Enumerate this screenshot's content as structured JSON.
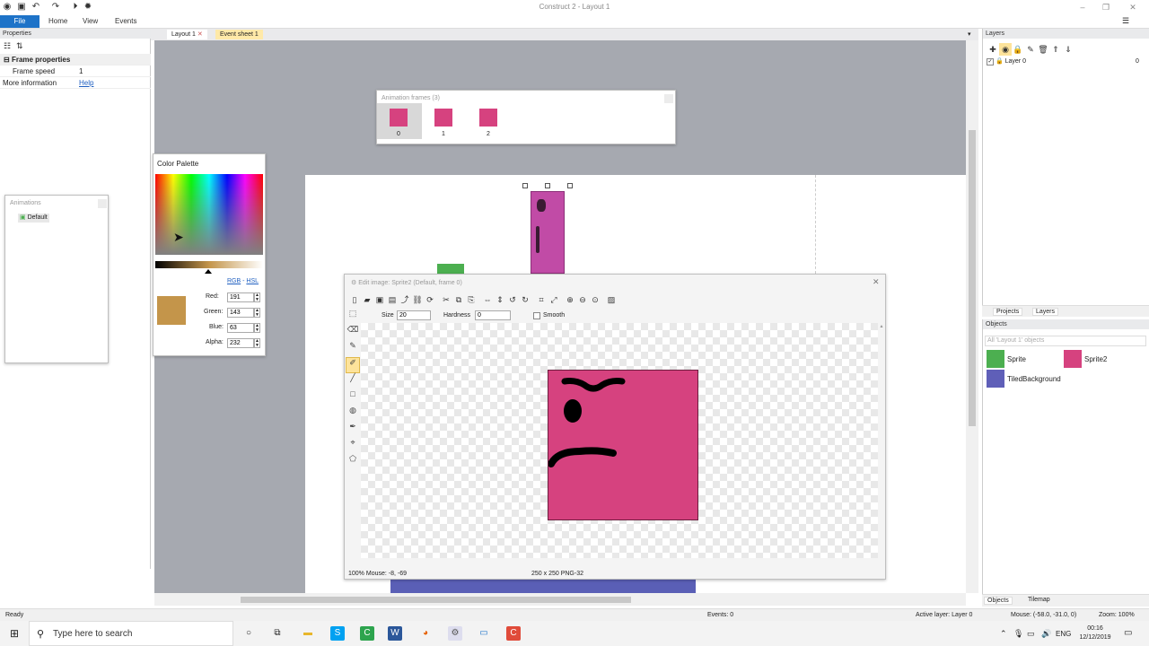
{
  "app": {
    "title": "Construct 2 - Layout 1"
  },
  "ribbon": {
    "file": "File",
    "home": "Home",
    "view": "View",
    "events": "Events"
  },
  "properties": {
    "title": "Properties",
    "section": "Frame properties",
    "rows": [
      {
        "label": "Frame speed",
        "value": "1"
      },
      {
        "label": "More information",
        "value": "Help"
      }
    ]
  },
  "doc_tabs": [
    {
      "label": "Layout 1"
    },
    {
      "label": "Event sheet 1"
    }
  ],
  "animation_frames": {
    "title": "Animation frames (3)",
    "frames": [
      "0",
      "1",
      "2"
    ]
  },
  "animations": {
    "title": "Animations",
    "items": [
      "Default"
    ]
  },
  "color_palette": {
    "title": "Color Palette",
    "mode_rgb": "RGB",
    "mode_sep": " - ",
    "mode_hsl": "HSL",
    "red_label": "Red:",
    "red": "191",
    "green_label": "Green:",
    "green": "143",
    "blue_label": "Blue:",
    "blue": "63",
    "alpha_label": "Alpha:",
    "alpha": "232",
    "swatch_color": "#c4954a"
  },
  "image_editor": {
    "title": "Edit image: Sprite2 (Default, frame 0)",
    "size_label": "Size",
    "size": "20",
    "hardness_label": "Hardness",
    "hardness": "0",
    "smooth_label": "Smooth",
    "status_zoom": "100%",
    "status_mouse": "Mouse: -8, -69",
    "status_dims": "250 x 250",
    "status_format": "PNG-32",
    "image_color": "#d6427f"
  },
  "layers": {
    "title": "Layers",
    "items": [
      {
        "name": "Layer 0",
        "index": "0"
      }
    ],
    "tab_projects": "Projects",
    "tab_layers": "Layers"
  },
  "objects": {
    "title": "Objects",
    "filter": "All 'Layout 1' objects",
    "items": [
      {
        "name": "Sprite",
        "color": "#4caf50"
      },
      {
        "name": "Sprite2",
        "color": "#d6427f"
      },
      {
        "name": "TiledBackground",
        "color": "#5f5fb8"
      }
    ],
    "tab_objects": "Objects",
    "tab_tilemap": "Tilemap"
  },
  "status": {
    "left": "Ready",
    "events": "Events: 0",
    "active_layer": "Active layer: Layer 0",
    "mouse": "Mouse: (-58.0, -31.0, 0)",
    "zoom": "Zoom: 100%"
  },
  "taskbar": {
    "search_placeholder": "Type here to search",
    "lang": "ENG",
    "time": "00:16",
    "date": "12/12/2019"
  }
}
